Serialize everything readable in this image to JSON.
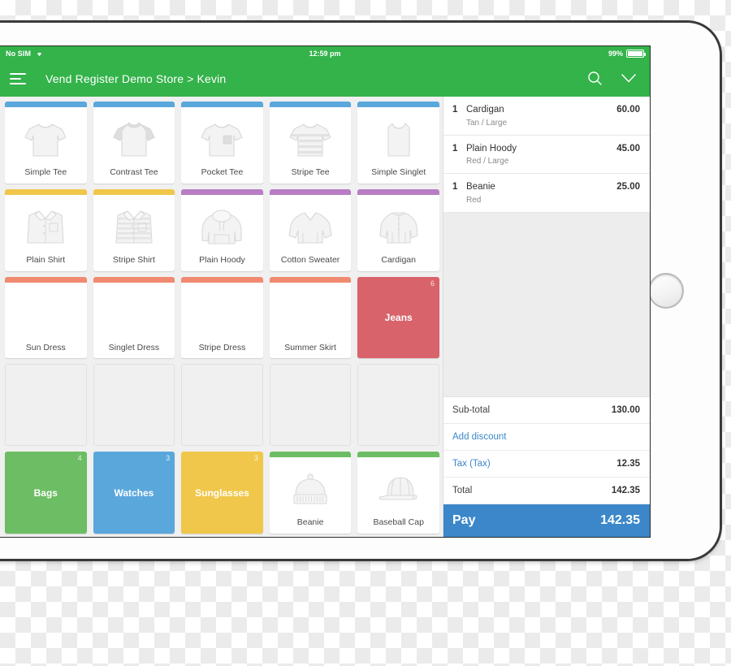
{
  "status_bar": {
    "carrier": "No SIM",
    "wifi_icon": "wifi-icon",
    "time": "12:59 pm",
    "battery_percent": "99%"
  },
  "header": {
    "menu_icon": "hamburger-menu-icon",
    "title": "Vend Register Demo Store > Kevin",
    "search_icon": "search-icon",
    "chevron_icon": "chevron-down-icon"
  },
  "grid": {
    "tiles": [
      {
        "label": "Simple Tee",
        "bar": "#5aa7dc",
        "art": "tee",
        "type": "product"
      },
      {
        "label": "Contrast Tee",
        "bar": "#5aa7dc",
        "art": "tee-contrast",
        "type": "product"
      },
      {
        "label": "Pocket Tee",
        "bar": "#5aa7dc",
        "art": "tee-pocket",
        "type": "product"
      },
      {
        "label": "Stripe Tee",
        "bar": "#5aa7dc",
        "art": "tee-stripe",
        "type": "product"
      },
      {
        "label": "Simple Singlet",
        "bar": "#5aa7dc",
        "art": "singlet",
        "type": "product"
      },
      {
        "label": "Plain Shirt",
        "bar": "#f0c74a",
        "art": "shirt",
        "type": "product"
      },
      {
        "label": "Stripe Shirt",
        "bar": "#f0c74a",
        "art": "shirt-stripe",
        "type": "product"
      },
      {
        "label": "Plain Hoody",
        "bar": "#b87dc4",
        "art": "hoody",
        "type": "product"
      },
      {
        "label": "Cotton Sweater",
        "bar": "#b87dc4",
        "art": "sweater",
        "type": "product"
      },
      {
        "label": "Cardigan",
        "bar": "#b87dc4",
        "art": "cardigan",
        "type": "product"
      },
      {
        "label": "Sun Dress",
        "bar": "#f08a70",
        "art": "none",
        "type": "product"
      },
      {
        "label": "Singlet Dress",
        "bar": "#f08a70",
        "art": "none",
        "type": "product"
      },
      {
        "label": "Stripe Dress",
        "bar": "#f08a70",
        "art": "none",
        "type": "product"
      },
      {
        "label": "Summer Skirt",
        "bar": "#f08a70",
        "art": "none",
        "type": "product"
      },
      {
        "label": "Jeans",
        "fill": "#d9636b",
        "badge": "6",
        "type": "category"
      },
      {
        "label": "",
        "type": "empty"
      },
      {
        "label": "",
        "type": "empty"
      },
      {
        "label": "",
        "type": "empty"
      },
      {
        "label": "",
        "type": "empty"
      },
      {
        "label": "",
        "type": "empty"
      },
      {
        "label": "Bags",
        "fill": "#6cbd63",
        "badge": "4",
        "type": "category"
      },
      {
        "label": "Watches",
        "fill": "#5aa7dc",
        "badge": "3",
        "type": "category"
      },
      {
        "label": "Sunglasses",
        "fill": "#f0c74a",
        "badge": "3",
        "type": "category"
      },
      {
        "label": "Beanie",
        "bar": "#6cbd63",
        "art": "beanie",
        "type": "product"
      },
      {
        "label": "Baseball Cap",
        "bar": "#6cbd63",
        "art": "cap",
        "type": "product"
      }
    ]
  },
  "cart": {
    "items": [
      {
        "qty": "1",
        "name": "Cardigan",
        "variant": "Tan / Large",
        "price": "60.00"
      },
      {
        "qty": "1",
        "name": "Plain Hoody",
        "variant": "Red / Large",
        "price": "45.00"
      },
      {
        "qty": "1",
        "name": "Beanie",
        "variant": "Red",
        "price": "25.00"
      }
    ],
    "totals": [
      {
        "label": "Sub-total",
        "amount": "130.00",
        "link": false
      },
      {
        "label": "Add discount",
        "amount": "",
        "link": true
      },
      {
        "label": "Tax (Tax)",
        "amount": "12.35",
        "link": true
      },
      {
        "label": "Total",
        "amount": "142.35",
        "link": false
      }
    ],
    "pay": {
      "label": "Pay",
      "amount": "142.35"
    }
  },
  "colors": {
    "brand_green": "#33b34a",
    "pay_blue": "#3b87c9",
    "link_blue": "#3b87c9",
    "tile_blue": "#5aa7dc",
    "tile_yellow": "#f0c74a",
    "tile_purple": "#b87dc4",
    "tile_coral": "#f08a70",
    "tile_red": "#d9636b",
    "tile_green": "#6cbd63"
  }
}
